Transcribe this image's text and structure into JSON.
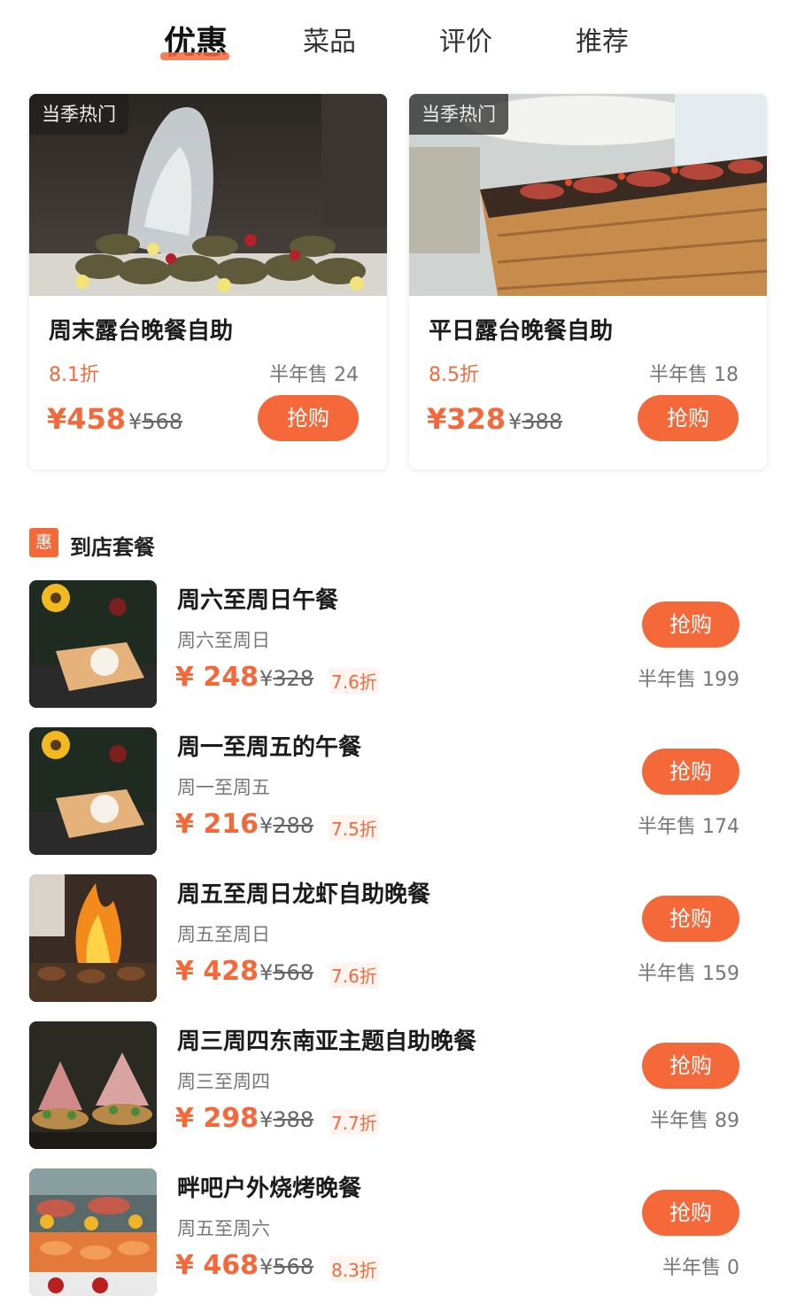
{
  "tabs": [
    {
      "label": "优惠",
      "active": true
    },
    {
      "label": "菜品",
      "active": false
    },
    {
      "label": "评价",
      "active": false
    },
    {
      "label": "推荐",
      "active": false
    }
  ],
  "featured": [
    {
      "tag": "当季热门",
      "title": "周末露台晚餐自助",
      "discount": "8.1折",
      "sold": "半年售 24",
      "price": "¥458",
      "orig_currency": "¥",
      "orig_price": "568",
      "buy_label": "抢购"
    },
    {
      "tag": "当季热门",
      "title": "平日露台晚餐自助",
      "discount": "8.5折",
      "sold": "半年售 18",
      "price": "¥328",
      "orig_currency": "¥",
      "orig_price": "388",
      "buy_label": "抢购"
    }
  ],
  "section": {
    "badge": "惠",
    "title": "到店套餐"
  },
  "items": [
    {
      "title": "周六至周日午餐",
      "subtitle": "周六至周日",
      "price": "¥ 248",
      "orig_currency": "¥",
      "orig_price": "328",
      "discount": "7.6折",
      "buy_label": "抢购",
      "sold": "半年售 199"
    },
    {
      "title": "周一至周五的午餐",
      "subtitle": "周一至周五",
      "price": "¥ 216",
      "orig_currency": "¥",
      "orig_price": "288",
      "discount": "7.5折",
      "buy_label": "抢购",
      "sold": "半年售 174"
    },
    {
      "title": "周五至周日龙虾自助晚餐",
      "subtitle": "周五至周日",
      "price": "¥ 428",
      "orig_currency": "¥",
      "orig_price": "568",
      "discount": "7.6折",
      "buy_label": "抢购",
      "sold": "半年售 159"
    },
    {
      "title": "周三周四东南亚主题自助晚餐",
      "subtitle": "周三至周四",
      "price": "¥ 298",
      "orig_currency": "¥",
      "orig_price": "388",
      "discount": "7.7折",
      "buy_label": "抢购",
      "sold": "半年售 89"
    },
    {
      "title": "畔吧户外烧烤晚餐",
      "subtitle": "周五至周六",
      "price": "¥ 468",
      "orig_currency": "¥",
      "orig_price": "568",
      "discount": "8.3折",
      "buy_label": "抢购",
      "sold": "半年售 0"
    }
  ],
  "colors": {
    "accent": "#f4683a",
    "background": "#ffffff",
    "text": "#1b1b1b",
    "muted": "#777777"
  }
}
